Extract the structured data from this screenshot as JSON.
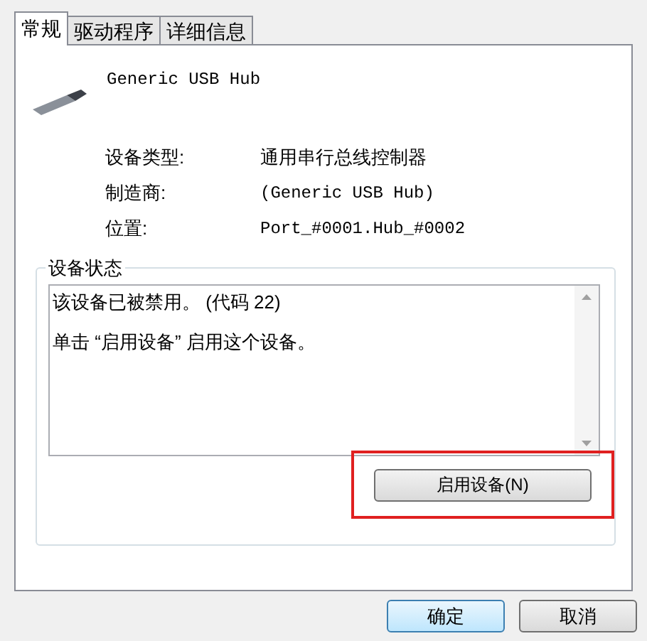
{
  "tabs": [
    {
      "label": "常规",
      "selected": true
    },
    {
      "label": "驱动程序",
      "selected": false
    },
    {
      "label": "详细信息",
      "selected": false
    }
  ],
  "device": {
    "name": "Generic USB Hub"
  },
  "properties": [
    {
      "label": "设备类型:",
      "value": "通用串行总线控制器",
      "kind": "text"
    },
    {
      "label": "制造商:",
      "value": "(Generic USB Hub)",
      "kind": "mono"
    },
    {
      "label": "位置:",
      "value": "Port_#0001.Hub_#0002",
      "kind": "mono"
    }
  ],
  "device_status": {
    "title": "设备状态",
    "lines": [
      "该设备已被禁用。 (代码 22)",
      "单击 “启用设备” 启用这个设备。"
    ]
  },
  "action_button": {
    "label": "启用设备(N)"
  },
  "buttons": [
    {
      "label": "确定",
      "default": true
    },
    {
      "label": "取消",
      "default": false
    }
  ]
}
